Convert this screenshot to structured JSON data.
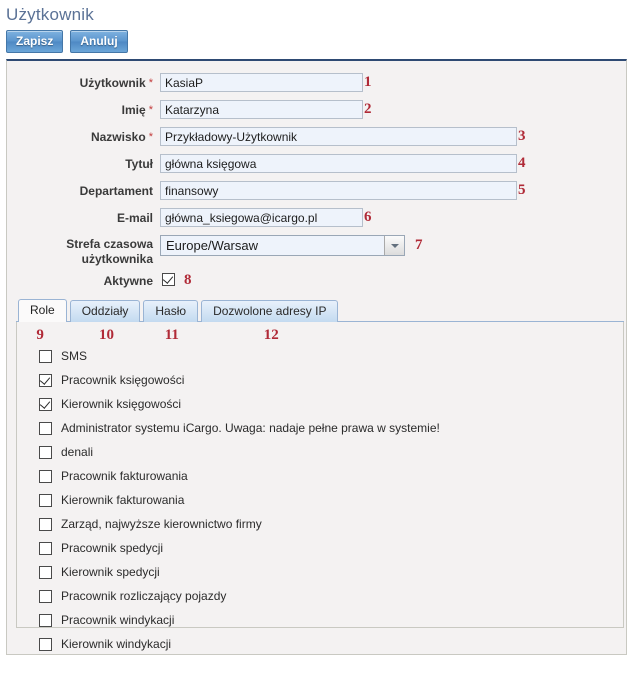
{
  "page": {
    "title": "Użytkownik"
  },
  "toolbar": {
    "save_label": "Zapisz",
    "cancel_label": "Anuluj"
  },
  "form": {
    "fields": [
      {
        "label": "Użytkownik",
        "required": true,
        "value": "KasiaP",
        "annotation": "1",
        "size": "sm"
      },
      {
        "label": "Imię",
        "required": true,
        "value": "Katarzyna",
        "annotation": "2",
        "size": "sm"
      },
      {
        "label": "Nazwisko",
        "required": true,
        "value": "Przykładowy-Użytkownik",
        "annotation": "3",
        "size": "lg"
      },
      {
        "label": "Tytuł",
        "required": false,
        "value": "główna księgowa",
        "annotation": "4",
        "size": "lg"
      },
      {
        "label": "Departament",
        "required": false,
        "value": "finansowy",
        "annotation": "5",
        "size": "lg"
      },
      {
        "label": "E-mail",
        "required": false,
        "value": "główna_ksiegowa@icargo.pl",
        "annotation": "6",
        "size": "em"
      }
    ],
    "timezone": {
      "label_line1": "Strefa czasowa",
      "label_line2": "użytkownika",
      "value": "Europe/Warsaw",
      "annotation": "7"
    },
    "active": {
      "label": "Aktywne",
      "checked": true,
      "annotation": "8"
    }
  },
  "tabs": [
    {
      "label": "Role",
      "active": true,
      "annotation": "9"
    },
    {
      "label": "Oddziały",
      "active": false,
      "annotation": "10"
    },
    {
      "label": "Hasło",
      "active": false,
      "annotation": "11"
    },
    {
      "label": "Dozwolone adresy IP",
      "active": false,
      "annotation": "12"
    }
  ],
  "roles": [
    {
      "label": "SMS",
      "checked": false
    },
    {
      "label": "Pracownik księgowości",
      "checked": true
    },
    {
      "label": "Kierownik księgowości",
      "checked": true
    },
    {
      "label": "Administrator systemu iCargo. Uwaga: nadaje pełne prawa w systemie!",
      "checked": false
    },
    {
      "label": "denali",
      "checked": false
    },
    {
      "label": "Pracownik fakturowania",
      "checked": false
    },
    {
      "label": "Kierownik fakturowania",
      "checked": false
    },
    {
      "label": "Zarząd, najwyższe kierownictwo firmy",
      "checked": false
    },
    {
      "label": "Pracownik spedycji",
      "checked": false
    },
    {
      "label": "Kierownik spedycji",
      "checked": false
    },
    {
      "label": "Pracownik rozliczający pojazdy",
      "checked": false
    },
    {
      "label": "Pracownik windykacji",
      "checked": false
    },
    {
      "label": "Kierownik windykacji",
      "checked": false
    }
  ],
  "colors": {
    "title": "#5b7296",
    "annotation": "#b02a37",
    "button": "#5b95cd",
    "panel_top_border": "#2e4a73"
  }
}
